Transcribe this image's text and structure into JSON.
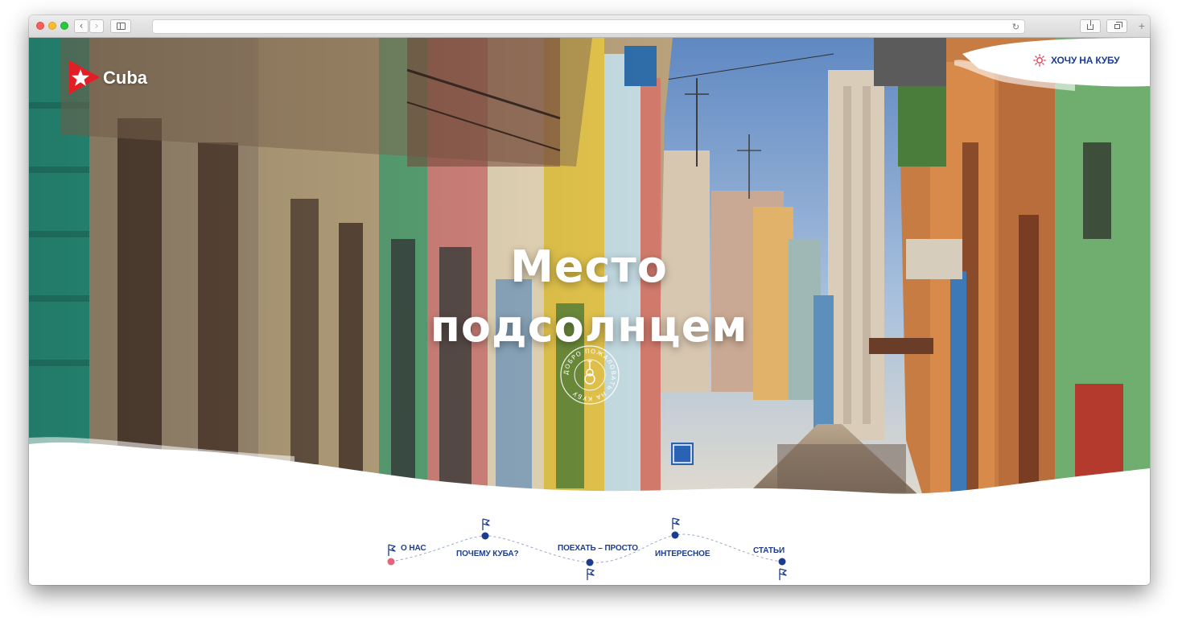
{
  "browser": {
    "url": "",
    "colors": {
      "close": "#fc5f57",
      "minimize": "#fdbc2e",
      "zoom": "#28c840"
    }
  },
  "site": {
    "logo_text": "Cuba",
    "cta_label": "ХОЧУ НА КУБУ",
    "hero_title_line1": "Место",
    "hero_title_line2": "подсолнцем",
    "stamp_text": "ДОБРО ПОЖАЛОВАТЬ НА КУБУ",
    "colors": {
      "brand_blue": "#1c3d8f",
      "logo_red": "#e31e24",
      "route_dot_active": "#e0677a"
    }
  },
  "nav_route": {
    "items": [
      {
        "label": "О НАС",
        "active": true
      },
      {
        "label": "ПОЧЕМУ КУБА?",
        "active": false
      },
      {
        "label": "ПОЕХАТЬ – ПРОСТО",
        "active": false
      },
      {
        "label": "ИНТЕРЕСНОЕ",
        "active": false
      },
      {
        "label": "СТАТЬИ",
        "active": false
      }
    ]
  },
  "icons": {
    "logo": "cuban-flag-star-icon",
    "cta": "sun-icon",
    "route_marker": "flag-icon"
  }
}
